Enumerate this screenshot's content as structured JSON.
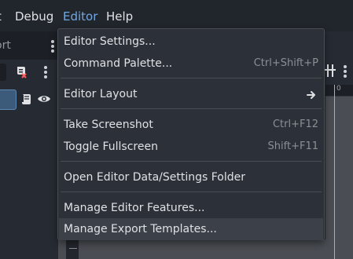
{
  "menubar": {
    "items": [
      {
        "label": "t"
      },
      {
        "label": "Debug"
      },
      {
        "label": "Editor"
      },
      {
        "label": "Help"
      }
    ]
  },
  "left_dock": {
    "tab_label": "ort"
  },
  "viewport": {
    "ruler_label": "0"
  },
  "editor_menu": {
    "items": [
      {
        "label": "Editor Settings...",
        "shortcut": ""
      },
      {
        "label": "Command Palette...",
        "shortcut": "Ctrl+Shift+P"
      },
      {
        "label": "Editor Layout",
        "shortcut": ""
      },
      {
        "label": "Take Screenshot",
        "shortcut": "Ctrl+F12"
      },
      {
        "label": "Toggle Fullscreen",
        "shortcut": "Shift+F11"
      },
      {
        "label": "Open Editor Data/Settings Folder",
        "shortcut": ""
      },
      {
        "label": "Manage Editor Features...",
        "shortcut": ""
      },
      {
        "label": "Manage Export Templates...",
        "shortcut": ""
      }
    ],
    "hovered_item": "Manage Export Templates..."
  },
  "colors": {
    "active_menu": "#72a8e2",
    "menu_bg": "#2c3038",
    "hover_bg": "#3b4049",
    "viewport_accent": "#a3c44a"
  },
  "icons": [
    "script-remove-icon",
    "kebab-menu-icon",
    "script-icon",
    "visibility-eye-icon",
    "submenu-arrow-icon",
    "anchor-icon"
  ]
}
